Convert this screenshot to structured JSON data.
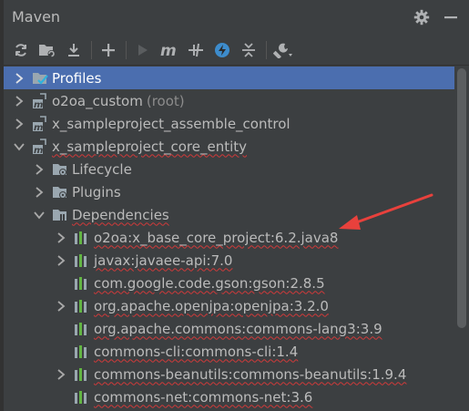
{
  "panel": {
    "title": "Maven"
  },
  "titlebar": {
    "settings_icon": "gear-icon",
    "hide_icon": "minimize-icon"
  },
  "toolbar": {
    "buttons": [
      {
        "icon": "reload-icon"
      },
      {
        "icon": "generate-sources-icon"
      },
      {
        "icon": "download-icon"
      },
      {
        "icon": "add-icon"
      },
      {
        "icon": "run-icon"
      },
      {
        "icon": "execute-goal-icon"
      },
      {
        "icon": "toggle-offline-icon"
      },
      {
        "icon": "skip-tests-icon"
      },
      {
        "icon": "collapse-all-icon"
      },
      {
        "icon": "settings-wrench-icon"
      }
    ]
  },
  "tree": {
    "profiles": "Profiles",
    "project1": {
      "name": "o2oa_custom",
      "suffix": "(root)"
    },
    "project2": "x_sampleproject_assemble_control",
    "project3": "x_sampleproject_core_entity",
    "lifecycle": "Lifecycle",
    "plugins": "Plugins",
    "dependencies": "Dependencies",
    "deps": [
      "o2oa:x_base_core_project:6.2.java8",
      "javax:javaee-api:7.0",
      "com.google.code.gson:gson:2.8.5",
      "org.apache.openjpa:openjpa:3.2.0",
      "org.apache.commons:commons-lang3:3.9",
      "commons-cli:commons-cli:1.4",
      "commons-beanutils:commons-beanutils:1.9.4",
      "commons-net:commons-net:3.6"
    ]
  },
  "colors": {
    "background": "#3c3f41",
    "selection": "#4b6eaf",
    "text": "#bbbbbb",
    "annotation_arrow": "#e8413c"
  }
}
